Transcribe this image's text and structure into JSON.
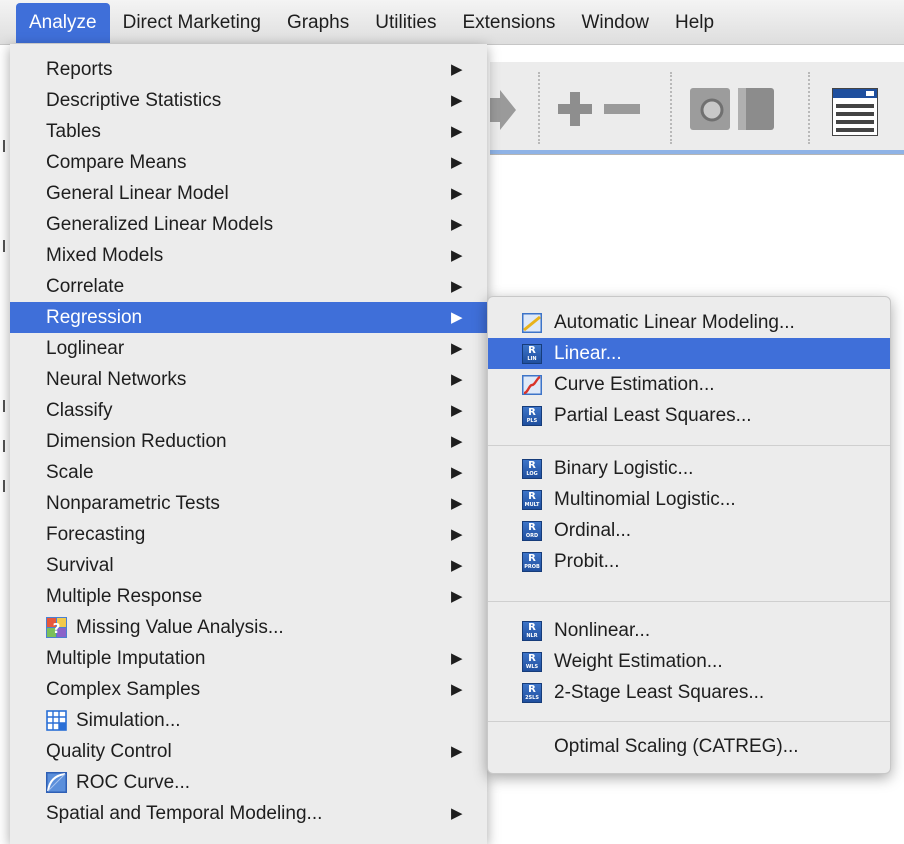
{
  "menubar": {
    "items": [
      {
        "label": "Analyze",
        "active": true
      },
      {
        "label": "Direct Marketing"
      },
      {
        "label": "Graphs"
      },
      {
        "label": "Utilities"
      },
      {
        "label": "Extensions"
      },
      {
        "label": "Window"
      },
      {
        "label": "Help"
      }
    ]
  },
  "analyze_menu": {
    "items": [
      {
        "label": "Reports",
        "submenu": true
      },
      {
        "label": "Descriptive Statistics",
        "submenu": true
      },
      {
        "label": "Tables",
        "submenu": true
      },
      {
        "label": "Compare Means",
        "submenu": true
      },
      {
        "label": "General Linear Model",
        "submenu": true
      },
      {
        "label": "Generalized Linear Models",
        "submenu": true
      },
      {
        "label": "Mixed Models",
        "submenu": true
      },
      {
        "label": "Correlate",
        "submenu": true
      },
      {
        "label": "Regression",
        "submenu": true,
        "highlighted": true
      },
      {
        "label": "Loglinear",
        "submenu": true
      },
      {
        "label": "Neural Networks",
        "submenu": true
      },
      {
        "label": "Classify",
        "submenu": true
      },
      {
        "label": "Dimension Reduction",
        "submenu": true
      },
      {
        "label": "Scale",
        "submenu": true
      },
      {
        "label": "Nonparametric Tests",
        "submenu": true
      },
      {
        "label": "Forecasting",
        "submenu": true
      },
      {
        "label": "Survival",
        "submenu": true
      },
      {
        "label": "Multiple Response",
        "submenu": true
      },
      {
        "label": "Missing Value Analysis...",
        "icon": "missing-value-icon"
      },
      {
        "label": "Multiple Imputation",
        "submenu": true
      },
      {
        "label": "Complex Samples",
        "submenu": true
      },
      {
        "label": "Simulation...",
        "icon": "simulation-icon"
      },
      {
        "label": "Quality Control",
        "submenu": true
      },
      {
        "label": "ROC Curve...",
        "icon": "roc-curve-icon"
      },
      {
        "label": "Spatial and Temporal Modeling...",
        "submenu": true
      }
    ],
    "arrow_glyph": "▶"
  },
  "regression_submenu": {
    "items": [
      {
        "label": "Automatic Linear Modeling...",
        "icon": "automatic-linear-icon"
      },
      {
        "label": "Linear...",
        "icon": "r-lin-icon",
        "badge": "LIN",
        "highlighted": true
      },
      {
        "label": "Curve Estimation...",
        "icon": "curve-estimation-icon"
      },
      {
        "label": "Partial Least Squares...",
        "icon": "r-pls-icon",
        "badge": "PLS"
      },
      {
        "label": "Binary Logistic...",
        "icon": "r-log-icon",
        "badge": "LOG"
      },
      {
        "label": "Multinomial Logistic...",
        "icon": "r-mult-icon",
        "badge": "MULT"
      },
      {
        "label": "Ordinal...",
        "icon": "r-ord-icon",
        "badge": "ORD"
      },
      {
        "label": "Probit...",
        "icon": "r-prob-icon",
        "badge": "PROB"
      },
      {
        "label": "Nonlinear...",
        "icon": "r-nlr-icon",
        "badge": "NLR"
      },
      {
        "label": "Weight Estimation...",
        "icon": "r-wls-icon",
        "badge": "WLS"
      },
      {
        "label": "2-Stage Least Squares...",
        "icon": "r-2sls-icon",
        "badge": "2SLS"
      },
      {
        "label": "Optimal Scaling (CATREG)..."
      }
    ],
    "r_letter": "R"
  },
  "colors": {
    "highlight": "#3f6fd9",
    "menu_bg": "#ececec",
    "r_icon": "#2a5cb0"
  }
}
